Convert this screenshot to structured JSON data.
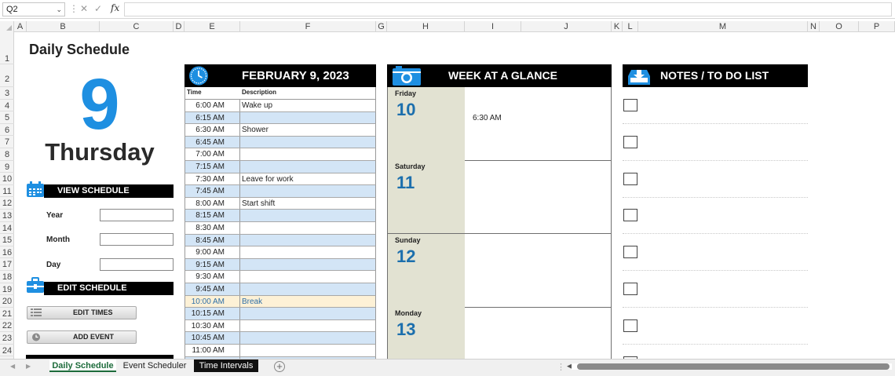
{
  "formula_bar": {
    "name_box": "Q2",
    "fx_label": "fx",
    "cancel_glyph": "✕",
    "confirm_glyph": "✓",
    "formula": ""
  },
  "columns": [
    "A",
    "B",
    "C",
    "D",
    "E",
    "F",
    "G",
    "H",
    "I",
    "J",
    "K",
    "L",
    "M",
    "N",
    "O",
    "P"
  ],
  "rows": [
    "1",
    "2",
    "3",
    "4",
    "5",
    "6",
    "7",
    "8",
    "9",
    "10",
    "11",
    "12",
    "13",
    "14",
    "15",
    "16",
    "17",
    "18",
    "19",
    "20",
    "21",
    "22",
    "23",
    "24"
  ],
  "left": {
    "title": "Daily Schedule",
    "day_number": "9",
    "day_name": "Thursday",
    "view_schedule_label": "VIEW SCHEDULE",
    "year_label": "Year",
    "month_label": "Month",
    "day_label": "Day",
    "year_value": "",
    "month_value": "",
    "day_value": "",
    "edit_schedule_label": "EDIT SCHEDULE",
    "edit_times_label": "EDIT TIMES",
    "add_event_label": "ADD EVENT",
    "icons": [
      "calendar-icon",
      "toolbox-icon",
      "list-icon",
      "clock-icon"
    ]
  },
  "schedule": {
    "date_header": "FEBRUARY 9, 2023",
    "time_col": "Time",
    "desc_col": "Description",
    "rows": [
      {
        "time": "6:00 AM",
        "desc": "Wake up"
      },
      {
        "time": "6:15 AM",
        "desc": ""
      },
      {
        "time": "6:30 AM",
        "desc": "Shower"
      },
      {
        "time": "6:45 AM",
        "desc": ""
      },
      {
        "time": "7:00 AM",
        "desc": ""
      },
      {
        "time": "7:15 AM",
        "desc": ""
      },
      {
        "time": "7:30 AM",
        "desc": "Leave for work"
      },
      {
        "time": "7:45 AM",
        "desc": ""
      },
      {
        "time": "8:00 AM",
        "desc": "Start shift"
      },
      {
        "time": "8:15 AM",
        "desc": ""
      },
      {
        "time": "8:30 AM",
        "desc": ""
      },
      {
        "time": "8:45 AM",
        "desc": ""
      },
      {
        "time": "9:00 AM",
        "desc": ""
      },
      {
        "time": "9:15 AM",
        "desc": ""
      },
      {
        "time": "9:30 AM",
        "desc": ""
      },
      {
        "time": "9:45 AM",
        "desc": ""
      },
      {
        "time": "10:00 AM",
        "desc": "Break"
      },
      {
        "time": "10:15 AM",
        "desc": ""
      },
      {
        "time": "10:30 AM",
        "desc": ""
      },
      {
        "time": "10:45 AM",
        "desc": ""
      },
      {
        "time": "11:00 AM",
        "desc": ""
      },
      {
        "time": "",
        "desc": ""
      }
    ],
    "colors": {
      "white": "#ffffff",
      "blue": "#d3e5f6",
      "highlight": "#fdf1d6",
      "highlight_text": "#2e6fa7"
    }
  },
  "week": {
    "title": "WEEK AT A GLANCE",
    "days": [
      {
        "name": "Friday",
        "num": "10",
        "event": "6:30 AM"
      },
      {
        "name": "Saturday",
        "num": "11",
        "event": ""
      },
      {
        "name": "Sunday",
        "num": "12",
        "event": ""
      },
      {
        "name": "Monday",
        "num": "13",
        "event": ""
      }
    ]
  },
  "notes": {
    "title": "NOTES / TO DO LIST"
  },
  "tabs": [
    {
      "label": "Daily Schedule",
      "state": "active"
    },
    {
      "label": "Event Scheduler",
      "state": "normal"
    },
    {
      "label": "Time Intervals",
      "state": "dark"
    }
  ],
  "colors": {
    "accent_blue": "#1e8fe1",
    "week_num_blue": "#1c6fad",
    "bar_black": "#000000",
    "tab_green": "#1d6b3b"
  }
}
